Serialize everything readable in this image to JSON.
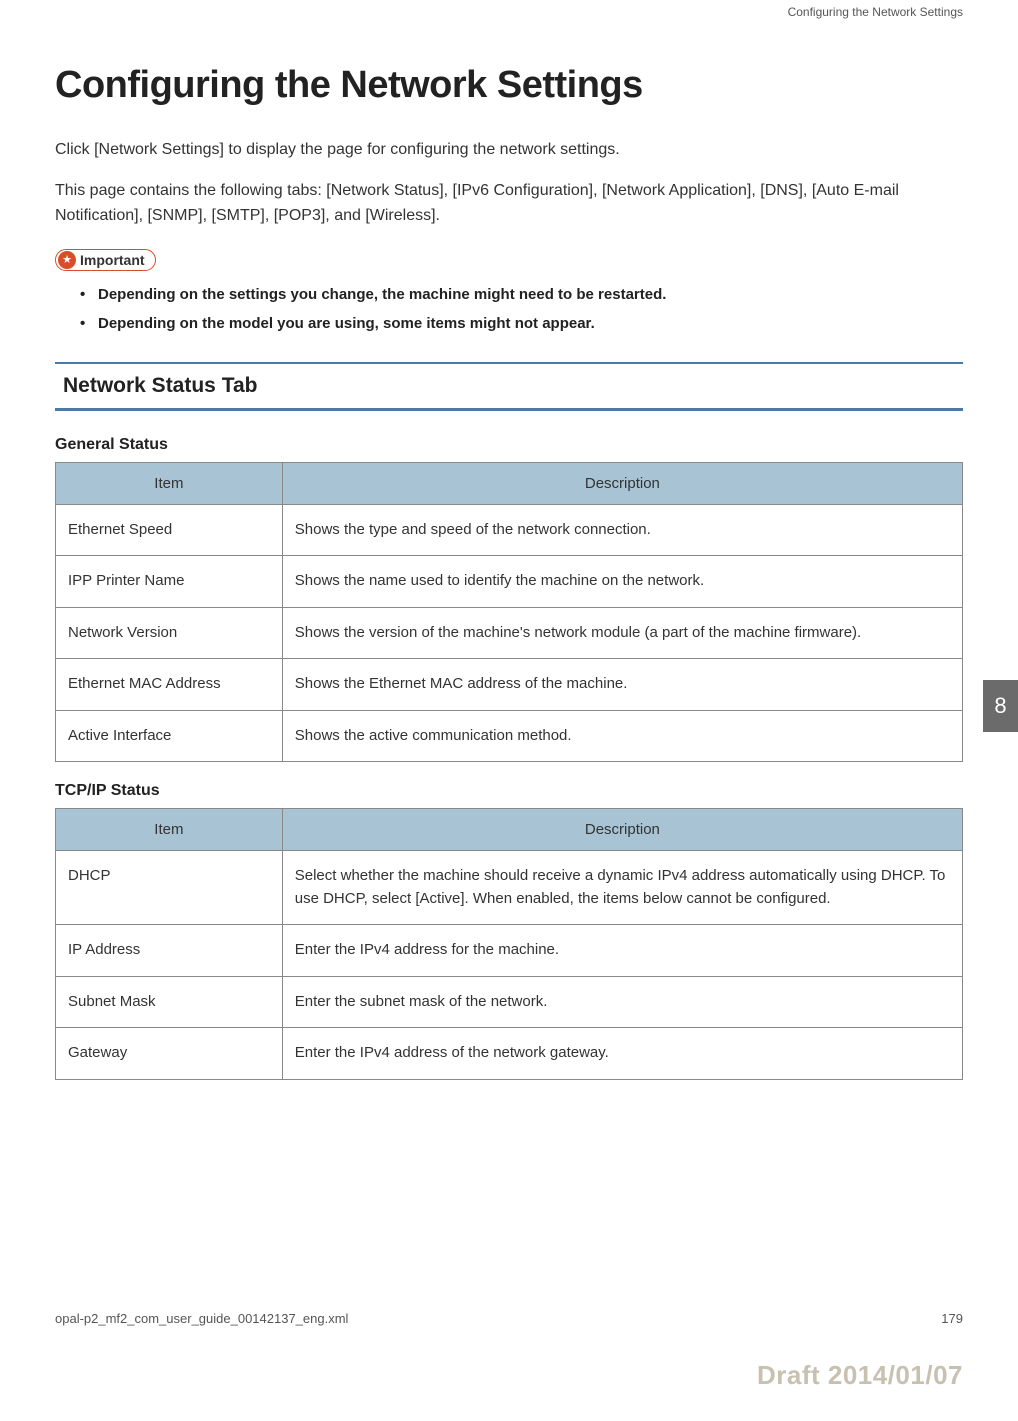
{
  "header": {
    "running_title": "Configuring the Network Settings"
  },
  "main": {
    "title": "Configuring the Network Settings",
    "intro_1": "Click [Network Settings] to display the page for configuring the network settings.",
    "intro_2": "This page contains the following tabs: [Network Status], [IPv6 Configuration], [Network Application], [DNS], [Auto E-mail Notification], [SNMP], [SMTP], [POP3], and [Wireless].",
    "important_label": "Important",
    "bullets": {
      "b1": "Depending on the settings you change, the machine might need to be restarted.",
      "b2": "Depending on the model you are using, some items might not appear."
    },
    "section_title": "Network Status Tab",
    "table1": {
      "title": "General Status",
      "col1": "Item",
      "col2": "Description",
      "rows": {
        "r1c1": "Ethernet Speed",
        "r1c2": "Shows the type and speed of the network connection.",
        "r2c1": "IPP Printer Name",
        "r2c2": "Shows the name used to identify the machine on the network.",
        "r3c1": "Network Version",
        "r3c2": "Shows the version of the machine's network module (a part of the machine firmware).",
        "r4c1": "Ethernet MAC Address",
        "r4c2": "Shows the Ethernet MAC address of the machine.",
        "r5c1": "Active Interface",
        "r5c2": "Shows the active communication method."
      }
    },
    "table2": {
      "title": "TCP/IP Status",
      "col1": "Item",
      "col2": "Description",
      "rows": {
        "r1c1": "DHCP",
        "r1c2": "Select whether the machine should receive a dynamic IPv4 address automatically using DHCP. To use DHCP, select [Active]. When enabled, the items below cannot be configured.",
        "r2c1": "IP Address",
        "r2c2": "Enter the IPv4 address for the machine.",
        "r3c1": "Subnet Mask",
        "r3c2": "Enter the subnet mask of the network.",
        "r4c1": "Gateway",
        "r4c2": "Enter the IPv4 address of the network gateway."
      }
    }
  },
  "page_tab": "8",
  "footer": {
    "left": "opal-p2_mf2_com_user_guide_00142137_eng.xml",
    "right": "179"
  },
  "watermark": "Draft 2014/01/07"
}
